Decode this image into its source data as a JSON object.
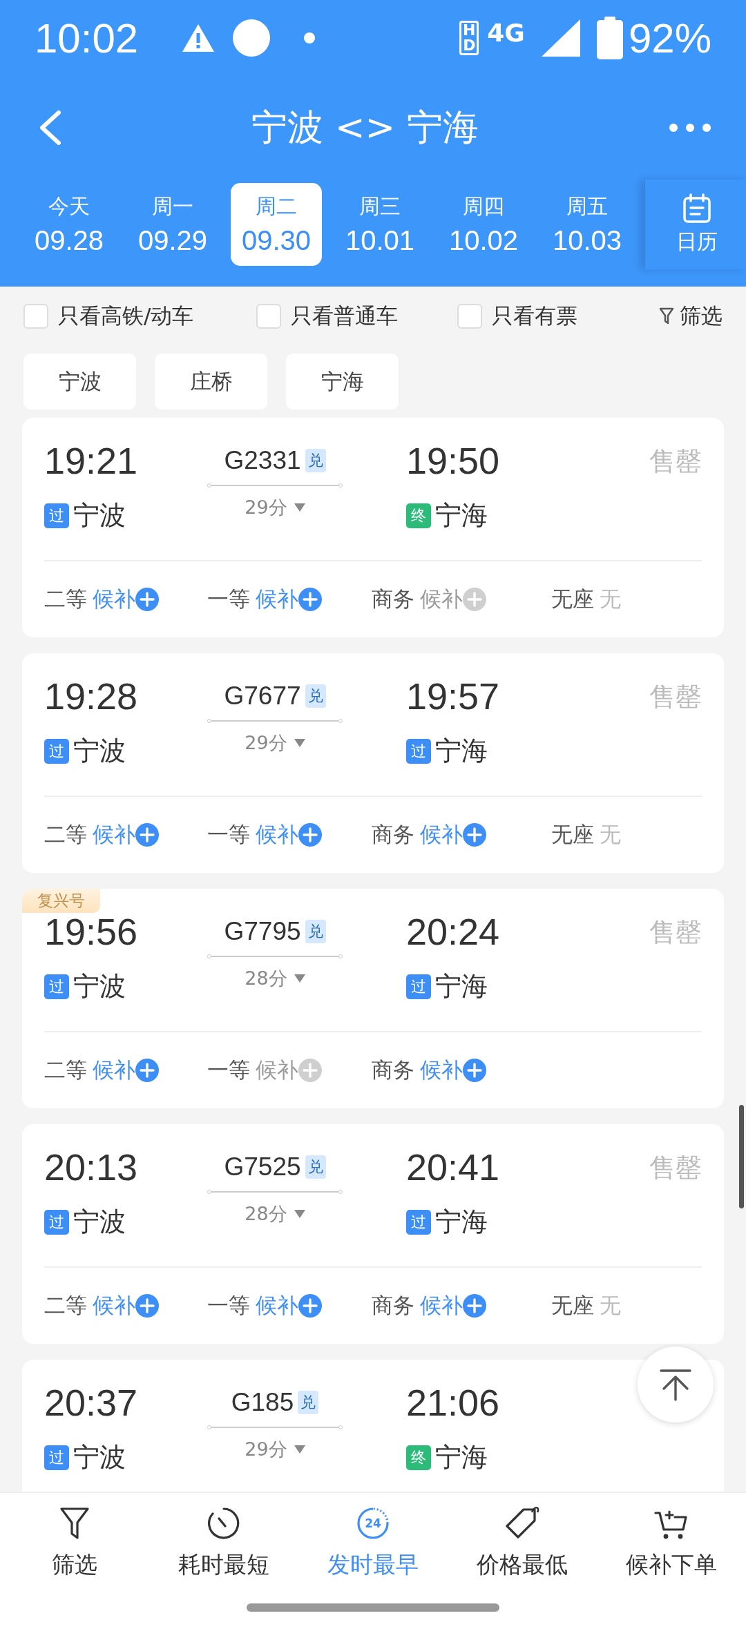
{
  "status_bar": {
    "time": "10:02",
    "hd": "HD",
    "network": "4G",
    "battery": "92%"
  },
  "header": {
    "title": "宁波 <> 宁海"
  },
  "dates": [
    {
      "day": "今天",
      "date": "09.28",
      "selected": false
    },
    {
      "day": "周一",
      "date": "09.29",
      "selected": false
    },
    {
      "day": "周二",
      "date": "09.30",
      "selected": true
    },
    {
      "day": "周三",
      "date": "10.01",
      "selected": false
    },
    {
      "day": "周四",
      "date": "10.02",
      "selected": false
    },
    {
      "day": "周五",
      "date": "10.03",
      "selected": false
    }
  ],
  "calendar": {
    "label": "日历"
  },
  "filters": [
    {
      "label": "只看高铁/动车",
      "checked": false
    },
    {
      "label": "只看普通车",
      "checked": false
    },
    {
      "label": "只看有票",
      "checked": false
    }
  ],
  "filter_button": "筛选",
  "stations": [
    "宁波",
    "庄桥",
    "宁海"
  ],
  "trains": [
    {
      "depart": "19:21",
      "number": "G2331",
      "exchange": "兑",
      "arrive": "19:50",
      "duration": "29分",
      "from": {
        "tag": "过",
        "color": "#3d8ef6",
        "name": "宁波"
      },
      "to": {
        "tag": "终",
        "color": "#2dbb7a",
        "name": "宁海"
      },
      "status": "售罄",
      "seats": [
        {
          "kind": "waitlist",
          "class": "二等",
          "text": "候补",
          "on": true
        },
        {
          "kind": "waitlist",
          "class": "一等",
          "text": "候补",
          "on": true
        },
        {
          "kind": "waitlist",
          "class": "商务",
          "text": "候补",
          "on": false
        },
        {
          "kind": "none",
          "class": "无座",
          "text": "无"
        }
      ]
    },
    {
      "depart": "19:28",
      "number": "G7677",
      "exchange": "兑",
      "arrive": "19:57",
      "duration": "29分",
      "from": {
        "tag": "过",
        "color": "#3d8ef6",
        "name": "宁波"
      },
      "to": {
        "tag": "过",
        "color": "#3d8ef6",
        "name": "宁海"
      },
      "status": "售罄",
      "seats": [
        {
          "kind": "waitlist",
          "class": "二等",
          "text": "候补",
          "on": true
        },
        {
          "kind": "waitlist",
          "class": "一等",
          "text": "候补",
          "on": true
        },
        {
          "kind": "waitlist",
          "class": "商务",
          "text": "候补",
          "on": true
        },
        {
          "kind": "none",
          "class": "无座",
          "text": "无"
        }
      ]
    },
    {
      "badge": "复兴号",
      "depart": "19:56",
      "number": "G7795",
      "exchange": "兑",
      "arrive": "20:24",
      "duration": "28分",
      "from": {
        "tag": "过",
        "color": "#3d8ef6",
        "name": "宁波"
      },
      "to": {
        "tag": "过",
        "color": "#3d8ef6",
        "name": "宁海"
      },
      "status": "售罄",
      "seats": [
        {
          "kind": "waitlist",
          "class": "二等",
          "text": "候补",
          "on": true
        },
        {
          "kind": "waitlist",
          "class": "一等",
          "text": "候补",
          "on": false
        },
        {
          "kind": "waitlist",
          "class": "商务",
          "text": "候补",
          "on": true
        }
      ]
    },
    {
      "depart": "20:13",
      "number": "G7525",
      "exchange": "兑",
      "arrive": "20:41",
      "duration": "28分",
      "from": {
        "tag": "过",
        "color": "#3d8ef6",
        "name": "宁波"
      },
      "to": {
        "tag": "过",
        "color": "#3d8ef6",
        "name": "宁海"
      },
      "status": "售罄",
      "seats": [
        {
          "kind": "waitlist",
          "class": "二等",
          "text": "候补",
          "on": true
        },
        {
          "kind": "waitlist",
          "class": "一等",
          "text": "候补",
          "on": true
        },
        {
          "kind": "waitlist",
          "class": "商务",
          "text": "候补",
          "on": true
        },
        {
          "kind": "none",
          "class": "无座",
          "text": "无"
        }
      ]
    },
    {
      "depart": "20:37",
      "number": "G185",
      "exchange": "兑",
      "arrive": "21:06",
      "duration": "29分",
      "from": {
        "tag": "过",
        "color": "#3d8ef6",
        "name": "宁波"
      },
      "to": {
        "tag": "终",
        "color": "#2dbb7a",
        "name": "宁海"
      }
    }
  ],
  "bottom_nav": [
    {
      "kind": "filter",
      "label": "筛选",
      "selected": false
    },
    {
      "kind": "timer",
      "label": "耗时最短",
      "selected": false
    },
    {
      "kind": "clock24",
      "label": "发时最早",
      "icon_text": "24",
      "selected": true
    },
    {
      "kind": "tag",
      "label": "价格最低",
      "selected": false
    },
    {
      "kind": "cart",
      "label": "候补下单",
      "selected": false
    }
  ]
}
